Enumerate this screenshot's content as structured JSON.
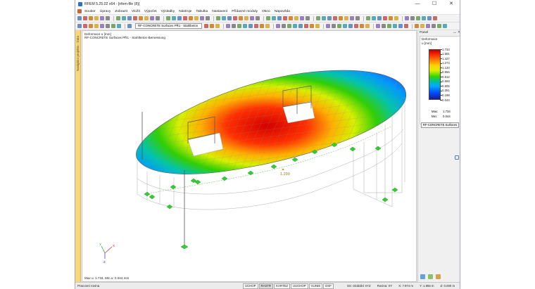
{
  "window": {
    "title": "RFEM 5.25.02 x64 - [nfem-file (8)]",
    "controls": {
      "minimize": "—",
      "maximize": "☐",
      "close": "✕"
    }
  },
  "menu": [
    "Soubor",
    "Úpravy",
    "Zobrazit",
    "Vložit",
    "Výpočet",
    "Výsledky",
    "Nástroje",
    "Tabulka",
    "Nastavení",
    "Přídavné moduly",
    "Okno",
    "Nápověda"
  ],
  "toolbar": {
    "results_combo": "RF-CONCRETE Surfaces PŘ1 - Stahlbeton"
  },
  "navigator": {
    "label": "Navigátor projektu - Data"
  },
  "view": {
    "header_line1": "Deformace u [mm]",
    "header_line2": "RF-CONCRETE Surfaces PŘ1 - Stahlbeton-Bemessung",
    "footer": "Max u: 1.734, Min u: 0.044 mm",
    "marker_value": "1.290",
    "axis_x": "X",
    "axis_y": "Y",
    "axis_z": "Z"
  },
  "panel": {
    "title": "Panel",
    "pin": "ꟷ",
    "close": "✕",
    "legend_title": "Deformace",
    "legend_unit": "u [mm]",
    "legend_values": [
      "1.734",
      "1.581",
      "1.427",
      "1.273",
      "1.120",
      "0.966",
      "0.812",
      "0.659",
      "0.505",
      "0.351",
      "0.198",
      "0.044"
    ],
    "max_label": "Max:",
    "max_value": "1.734",
    "min_label": "Min:",
    "min_value": "0.044",
    "button_label": "RF-CONCRETE Surfaces"
  },
  "statusbar": {
    "text": "Pracovní rovina",
    "toggles": [
      "UCHOP",
      "RASTR",
      "KARTEZ",
      "UUCHOP",
      "VLINIE",
      "DXF"
    ],
    "active_toggles": [
      "RASTR"
    ],
    "coords": [
      "SS: Globální XYZ",
      "Rovina: XY",
      "X: 7.974 m",
      "Y: 1.955 m",
      "Z: 0.000 m"
    ]
  },
  "colors": {
    "titlebar": "#ffffff",
    "navigator_strip": "#f8d77b",
    "support": "#33cc33",
    "beam": "#666666",
    "mesh": "#8a8a8a"
  }
}
